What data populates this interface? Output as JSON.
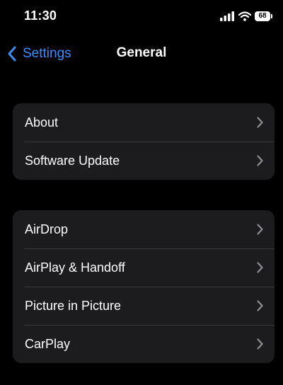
{
  "status_bar": {
    "time": "11:30",
    "battery_level": "68",
    "icons": [
      "signal-bars-icon",
      "wifi-icon",
      "battery-icon"
    ]
  },
  "nav": {
    "back_label": "Settings",
    "title": "General"
  },
  "groups": [
    {
      "items": [
        {
          "label": "About"
        },
        {
          "label": "Software Update"
        }
      ]
    },
    {
      "items": [
        {
          "label": "AirDrop"
        },
        {
          "label": "AirPlay & Handoff"
        },
        {
          "label": "Picture in Picture"
        },
        {
          "label": "CarPlay"
        }
      ]
    }
  ],
  "colors": {
    "background": "#000000",
    "group_background": "#1c1c1e",
    "separator": "#38383a",
    "accent": "#3a8dff",
    "chevron": "#8e8e93"
  }
}
